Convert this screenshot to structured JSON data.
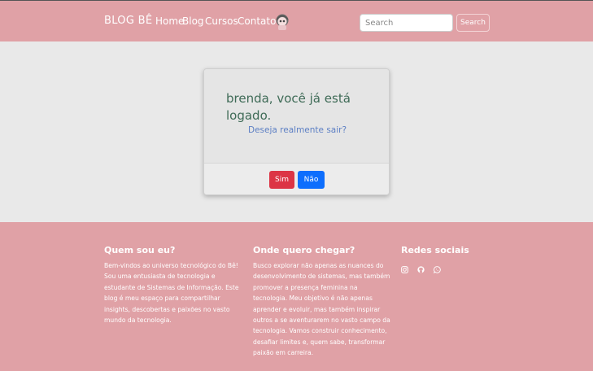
{
  "navbar": {
    "brand": "BLOG BÊ",
    "links": [
      "Home",
      "Blog",
      "Cursos",
      "Contato"
    ],
    "search_placeholder": "Search",
    "search_button": "Search"
  },
  "card": {
    "title": "brenda, você já está logado.",
    "question": "Deseja realmente sair?",
    "yes_label": "Sim",
    "no_label": "Não"
  },
  "footer": {
    "about_title": "Quem sou eu?",
    "about_text": "Bem-vindos ao universo tecnológico do Bê! Sou uma entusiasta de tecnologia e estudante de Sistemas de Informação. Este blog é meu espaço para compartilhar insights, descobertas e paixões no vasto mundo da tecnologia.",
    "goal_title": "Onde quero chegar?",
    "goal_text": "Busco explorar não apenas as nuances do desenvolvimento de sistemas, mas também promover a presença feminina na tecnologia. Meu objetivo é não apenas aprender e evoluir, mas também inspirar outros a se aventurarem no vasto campo da tecnologia. Vamos construir conhecimento, desafiar limites e, quem sabe, transformar paixão em carreira.",
    "social_title": "Redes sociais",
    "social_icons": [
      "instagram-icon",
      "github-icon",
      "whatsapp-icon"
    ]
  },
  "colors": {
    "pink": "#e0a1a6",
    "main_bg": "#e9e9e9",
    "title_green": "#3f6b57",
    "link_blue": "#5c7fc4",
    "danger": "#dc3545",
    "primary": "#0d6efd"
  }
}
